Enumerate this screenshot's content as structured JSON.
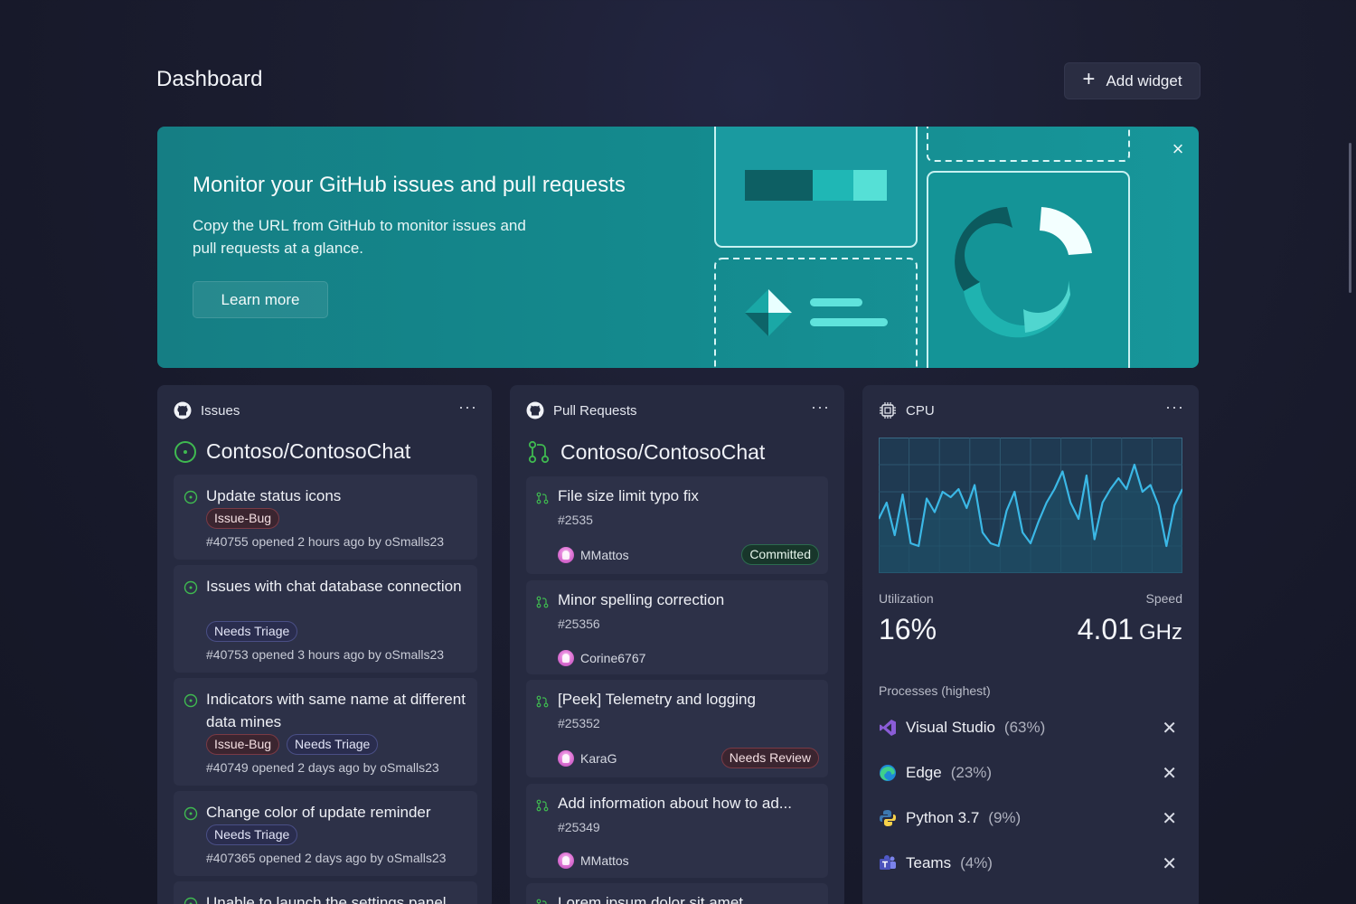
{
  "page": {
    "title": "Dashboard",
    "add_widget_label": "Add widget"
  },
  "banner": {
    "title": "Monitor your GitHub issues and pull requests",
    "description": "Copy the URL from GitHub to monitor issues and pull requests at a glance.",
    "learn_more_label": "Learn more",
    "close_icon": "close-icon"
  },
  "issues": {
    "header": "Issues",
    "repo": "Contoso/ContosoChat",
    "items": [
      {
        "title": "Update status icons",
        "tags": [
          "Issue-Bug"
        ],
        "meta": "#40755 opened 2 hours ago by oSmalls23"
      },
      {
        "title": "Issues with chat database connection",
        "tags": [
          "Needs Triage"
        ],
        "meta": "#40753 opened 3 hours ago by oSmalls23"
      },
      {
        "title": "Indicators with same name at different data mines",
        "tags": [
          "Issue-Bug",
          "Needs Triage"
        ],
        "meta": "#40749 opened 2 days ago by oSmalls23"
      },
      {
        "title": "Change color of update reminder",
        "tags": [
          "Needs Triage"
        ],
        "meta": "#407365 opened 2 days ago by oSmalls23"
      },
      {
        "title": "Unable to launch the settings panel"
      }
    ]
  },
  "pull_requests": {
    "header": "Pull Requests",
    "repo": "Contoso/ContosoChat",
    "items": [
      {
        "title": "File size limit typo fix",
        "number": "#2535",
        "author": "MMattos",
        "status": "Committed"
      },
      {
        "title": "Minor spelling correction",
        "number": "#25356",
        "author": "Corine6767"
      },
      {
        "title": "[Peek] Telemetry and logging",
        "number": "#25352",
        "author": "KaraG",
        "status": "Needs Review"
      },
      {
        "title": "Add information about how to ad...",
        "number": "#25349",
        "author": "MMattos"
      },
      {
        "title": "Lorem ipsum dolor sit amet"
      }
    ]
  },
  "cpu": {
    "header": "CPU",
    "utilization_label": "Utilization",
    "utilization_value": "16%",
    "speed_label": "Speed",
    "speed_value": "4.01",
    "speed_unit": "GHz",
    "processes_label": "Processes (highest)",
    "processes": [
      {
        "name": "Visual Studio",
        "pct": "(63%)",
        "icon": "visual-studio-icon"
      },
      {
        "name": "Edge",
        "pct": "(23%)",
        "icon": "edge-icon"
      },
      {
        "name": "Python 3.7",
        "pct": "(9%)",
        "icon": "python-icon"
      },
      {
        "name": "Teams",
        "pct": "(4%)",
        "icon": "teams-icon"
      }
    ],
    "history": [
      40,
      52,
      28,
      58,
      22,
      20,
      55,
      45,
      60,
      56,
      62,
      48,
      65,
      30,
      22,
      20,
      46,
      60,
      30,
      22,
      38,
      52,
      62,
      75,
      52,
      40,
      72,
      25,
      52,
      62,
      70,
      62,
      80,
      60,
      65,
      50,
      20,
      50,
      62
    ],
    "accent": "#3bb8e6"
  },
  "colors": {
    "banner": "#14898d",
    "card": "#262a40",
    "item": "#2d3148",
    "open_green": "#3fb950"
  }
}
